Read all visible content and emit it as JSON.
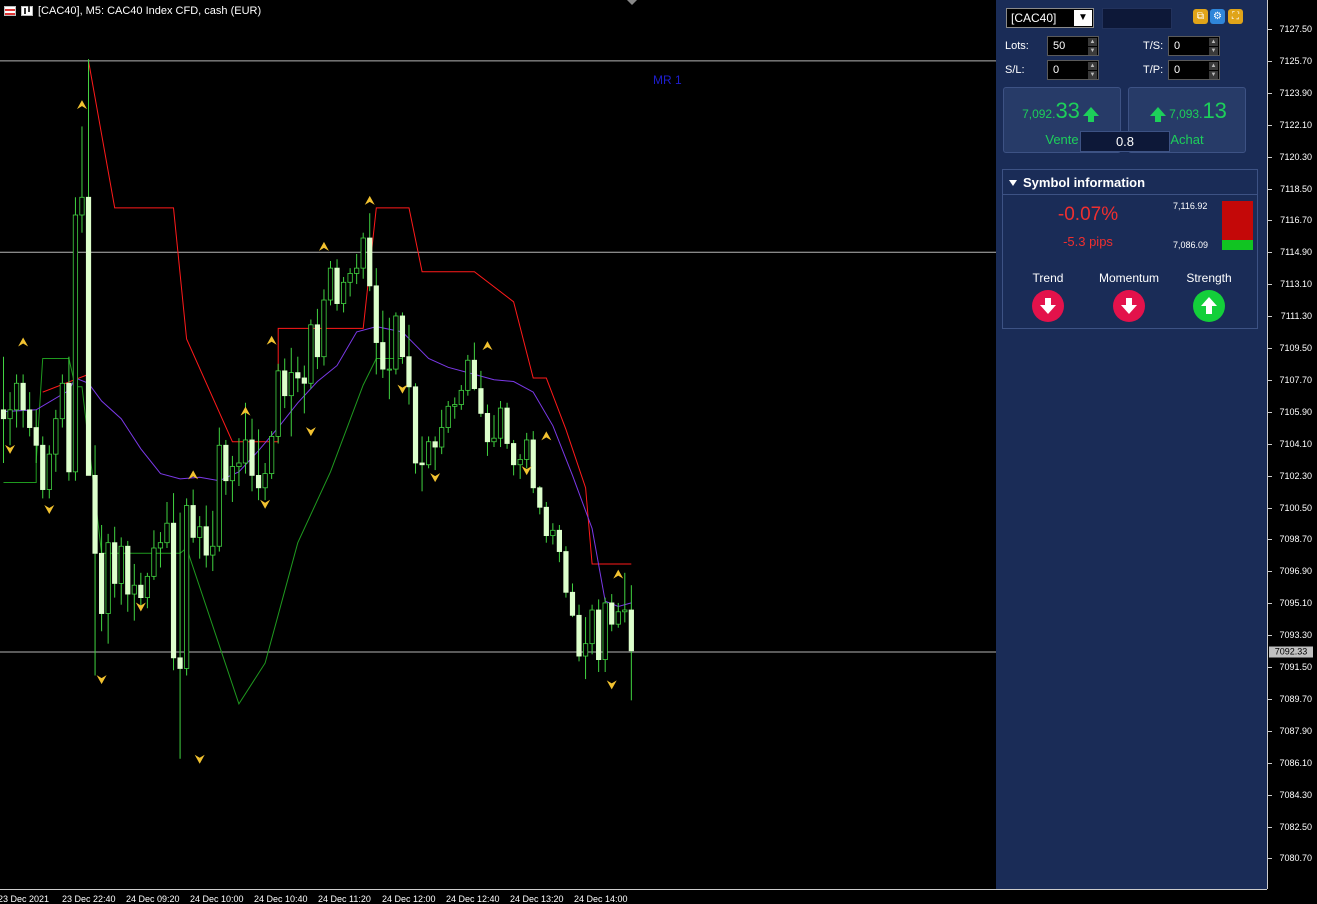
{
  "window": {
    "title": "[CAC40], M5:  CAC40 Index CFD, cash (EUR)",
    "chart_label": "MR 1"
  },
  "price_axis": {
    "ticks": [
      "7127.50",
      "7125.70",
      "7123.90",
      "7122.10",
      "7120.30",
      "7118.50",
      "7116.70",
      "7114.90",
      "7113.10",
      "7111.30",
      "7109.50",
      "7107.70",
      "7105.90",
      "7104.10",
      "7102.30",
      "7100.50",
      "7098.70",
      "7096.90",
      "7095.10",
      "7093.30",
      "7091.50",
      "7089.70",
      "7087.90",
      "7086.10",
      "7084.30",
      "7082.50",
      "7080.70"
    ],
    "current_price": "7092.33"
  },
  "time_axis": {
    "labels": [
      "23 Dec 2021",
      "23 Dec 22:40",
      "24 Dec 09:20",
      "24 Dec 10:00",
      "24 Dec 10:40",
      "24 Dec 11:20",
      "24 Dec 12:00",
      "24 Dec 12:40",
      "24 Dec 13:20",
      "24 Dec 14:00"
    ]
  },
  "panel": {
    "symbol": "[CAC40]",
    "lots_label": "Lots:",
    "lots_value": "50",
    "ts_label": "T/S:",
    "ts_value": "0",
    "sl_label": "S/L:",
    "sl_value": "0",
    "tp_label": "T/P:",
    "tp_value": "0",
    "sell": {
      "small": "7,092.",
      "big": "33",
      "label": "Vente"
    },
    "buy": {
      "small": "7,093.",
      "big": "13",
      "label": "Achat"
    },
    "spread": "0.8",
    "symbol_info": {
      "title": "Symbol information",
      "change_pct": "-0.07%",
      "change_pips": "-5.3 pips",
      "high": "7,116.92",
      "low": "7,086.09",
      "trend_label": "Trend",
      "trend": "down",
      "momentum_label": "Momentum",
      "momentum": "down",
      "strength_label": "Strength",
      "strength": "up"
    }
  },
  "colors": {
    "candle": "#ddffcc",
    "upper_band": "#ff1a1a",
    "lower_band": "#1f9a1f",
    "moving_average": "#7b39e8",
    "fractal": "#f2c230",
    "up_price": "#1dcf5a",
    "down_change": "#ef2f2f"
  },
  "chart_data": {
    "type": "candlestick",
    "symbol": "CAC40",
    "timeframe": "M5",
    "horizontal_levels": [
      7125.7,
      7114.9,
      7092.33
    ],
    "candles": [
      [
        7106.0,
        7109.0,
        7103.0,
        7105.5
      ],
      [
        7105.5,
        7107.0,
        7104.0,
        7106.0
      ],
      [
        7106.0,
        7108.0,
        7105.0,
        7107.5
      ],
      [
        7107.5,
        7108.0,
        7105.0,
        7106.0
      ],
      [
        7106.0,
        7107.0,
        7104.5,
        7105.0
      ],
      [
        7105.0,
        7106.0,
        7103.0,
        7104.0
      ],
      [
        7104.0,
        7104.5,
        7101.0,
        7101.5
      ],
      [
        7101.5,
        7104.0,
        7101.0,
        7103.5
      ],
      [
        7103.5,
        7106.0,
        7102.5,
        7105.5
      ],
      [
        7105.5,
        7108.0,
        7105.0,
        7107.5
      ],
      [
        7107.5,
        7109.0,
        7102.0,
        7102.5
      ],
      [
        7102.5,
        7118.0,
        7102.0,
        7117.0
      ],
      [
        7117.0,
        7122.0,
        7116.0,
        7118.0
      ],
      [
        7118.0,
        7125.8,
        7103.0,
        7102.3
      ],
      [
        7102.3,
        7104.0,
        7091.0,
        7097.9
      ],
      [
        7097.9,
        7099.5,
        7093.5,
        7094.5
      ],
      [
        7094.5,
        7099.0,
        7092.8,
        7098.5
      ],
      [
        7098.5,
        7099.4,
        7095.4,
        7096.2
      ],
      [
        7096.2,
        7098.8,
        7095.0,
        7098.3
      ],
      [
        7098.3,
        7098.6,
        7094.6,
        7095.6
      ],
      [
        7095.6,
        7097.3,
        7094.1,
        7096.1
      ],
      [
        7096.1,
        7096.8,
        7094.8,
        7095.4
      ],
      [
        7095.4,
        7096.8,
        7094.8,
        7096.6
      ],
      [
        7096.6,
        7099.2,
        7096.4,
        7098.2
      ],
      [
        7098.2,
        7099.1,
        7097.1,
        7098.5
      ],
      [
        7098.5,
        7100.8,
        7098.2,
        7099.6
      ],
      [
        7099.6,
        7101.3,
        7091.3,
        7092.0
      ],
      [
        7092.0,
        7100.2,
        7086.3,
        7091.4
      ],
      [
        7091.4,
        7101.0,
        7091.0,
        7100.6
      ],
      [
        7100.6,
        7101.5,
        7098.5,
        7098.8
      ],
      [
        7098.8,
        7100.0,
        7097.6,
        7099.4
      ],
      [
        7099.4,
        7100.6,
        7097.1,
        7097.8
      ],
      [
        7097.8,
        7100.3,
        7096.9,
        7098.3
      ],
      [
        7098.3,
        7105.0,
        7098.0,
        7104.0
      ],
      [
        7104.0,
        7104.3,
        7101.2,
        7102.0
      ],
      [
        7102.0,
        7103.4,
        7100.8,
        7102.8
      ],
      [
        7102.8,
        7104.4,
        7101.7,
        7103.0
      ],
      [
        7103.0,
        7106.4,
        7102.4,
        7104.3
      ],
      [
        7104.3,
        7105.5,
        7101.4,
        7102.3
      ],
      [
        7102.3,
        7104.9,
        7100.9,
        7101.6
      ],
      [
        7101.6,
        7103.0,
        7100.9,
        7102.4
      ],
      [
        7102.4,
        7104.8,
        7102.1,
        7104.5
      ],
      [
        7104.5,
        7108.6,
        7104.1,
        7108.2
      ],
      [
        7108.2,
        7108.9,
        7106.1,
        7106.8
      ],
      [
        7106.8,
        7109.5,
        7104.5,
        7108.1
      ],
      [
        7108.1,
        7109.0,
        7107.0,
        7107.8
      ],
      [
        7107.8,
        7108.5,
        7105.8,
        7107.5
      ],
      [
        7107.5,
        7111.1,
        7107.2,
        7110.8
      ],
      [
        7110.8,
        7111.7,
        7108.3,
        7109.0
      ],
      [
        7109.0,
        7112.8,
        7108.5,
        7112.2
      ],
      [
        7112.2,
        7114.4,
        7111.9,
        7114.0
      ],
      [
        7114.0,
        7114.5,
        7111.6,
        7112.0
      ],
      [
        7112.0,
        7113.5,
        7111.5,
        7113.2
      ],
      [
        7113.2,
        7114.0,
        7112.4,
        7113.7
      ],
      [
        7113.7,
        7114.8,
        7113.1,
        7114.0
      ],
      [
        7114.0,
        7116.0,
        7113.4,
        7115.7
      ],
      [
        7115.7,
        7117.1,
        7112.7,
        7113.0
      ],
      [
        7113.0,
        7114.0,
        7108.0,
        7109.8
      ],
      [
        7109.8,
        7111.6,
        7107.8,
        7108.3
      ],
      [
        7108.3,
        7111.2,
        7106.6,
        7108.3
      ],
      [
        7108.3,
        7111.5,
        7108.0,
        7111.3
      ],
      [
        7111.3,
        7111.5,
        7108.6,
        7109.0
      ],
      [
        7109.0,
        7110.8,
        7106.3,
        7107.3
      ],
      [
        7107.3,
        7107.5,
        7102.4,
        7103.0
      ],
      [
        7103.0,
        7104.5,
        7101.4,
        7102.9
      ],
      [
        7102.9,
        7104.5,
        7102.7,
        7104.2
      ],
      [
        7104.2,
        7104.5,
        7102.6,
        7103.9
      ],
      [
        7103.9,
        7106.0,
        7103.5,
        7105.0
      ],
      [
        7105.0,
        7106.5,
        7104.7,
        7106.2
      ],
      [
        7106.2,
        7106.7,
        7105.5,
        7106.3
      ],
      [
        7106.3,
        7107.4,
        7106.0,
        7107.1
      ],
      [
        7107.1,
        7109.1,
        7106.8,
        7108.8
      ],
      [
        7108.8,
        7109.8,
        7107.1,
        7107.2
      ],
      [
        7107.2,
        7108.2,
        7105.6,
        7105.8
      ],
      [
        7105.8,
        7106.3,
        7103.4,
        7104.2
      ],
      [
        7104.2,
        7105.7,
        7103.9,
        7104.4
      ],
      [
        7104.4,
        7106.5,
        7103.9,
        7106.1
      ],
      [
        7106.1,
        7106.4,
        7103.8,
        7104.1
      ],
      [
        7104.1,
        7104.3,
        7102.3,
        7102.9
      ],
      [
        7102.9,
        7103.5,
        7102.1,
        7103.2
      ],
      [
        7103.2,
        7104.7,
        7102.7,
        7104.3
      ],
      [
        7104.3,
        7104.8,
        7101.3,
        7101.6
      ],
      [
        7101.6,
        7101.7,
        7100.1,
        7100.5
      ],
      [
        7100.5,
        7100.8,
        7098.5,
        7098.9
      ],
      [
        7098.9,
        7099.6,
        7098.4,
        7099.2
      ],
      [
        7099.2,
        7099.5,
        7097.4,
        7098.0
      ],
      [
        7098.0,
        7098.3,
        7095.4,
        7095.7
      ],
      [
        7095.7,
        7096.2,
        7094.3,
        7094.4
      ],
      [
        7094.4,
        7095.0,
        7091.8,
        7092.1
      ],
      [
        7092.1,
        7094.3,
        7090.8,
        7092.8
      ],
      [
        7092.8,
        7095.0,
        7092.2,
        7094.7
      ],
      [
        7094.7,
        7095.3,
        7091.2,
        7091.9
      ],
      [
        7091.9,
        7095.4,
        7091.2,
        7095.1
      ],
      [
        7095.1,
        7095.6,
        7093.5,
        7093.9
      ],
      [
        7093.9,
        7095.1,
        7093.7,
        7094.6
      ],
      [
        7094.6,
        7096.8,
        7094.0,
        7094.7
      ],
      [
        7094.7,
        7096.1,
        7089.6,
        7092.4
      ]
    ],
    "upper_band": [
      [
        6,
        7107
      ],
      [
        13,
        7108
      ],
      [
        13,
        7125.7
      ],
      [
        17,
        7117.4
      ],
      [
        26,
        7117.4
      ],
      [
        28,
        7110
      ],
      [
        35,
        7104.2
      ],
      [
        42,
        7104.2
      ],
      [
        42,
        7110.6
      ],
      [
        52,
        7110.6
      ],
      [
        55,
        7110.6
      ],
      [
        57,
        7117.4
      ],
      [
        62,
        7117.4
      ],
      [
        64,
        7113.8
      ],
      [
        72,
        7113.8
      ],
      [
        78,
        7112.1
      ],
      [
        81,
        7107.8
      ],
      [
        83,
        7107.8
      ],
      [
        86,
        7104.9
      ],
      [
        89,
        7101.6
      ],
      [
        90,
        7097.3
      ],
      [
        96,
        7097.3
      ]
    ],
    "moving_average": [
      [
        0,
        7105.9
      ],
      [
        5,
        7106.0
      ],
      [
        10,
        7107.1
      ],
      [
        11,
        7107.8
      ],
      [
        13,
        7107.5
      ],
      [
        15,
        7106.5
      ],
      [
        18,
        7105.5
      ],
      [
        21,
        7103.8
      ],
      [
        24,
        7102.4
      ],
      [
        27,
        7102.1
      ],
      [
        30,
        7102.2
      ],
      [
        33,
        7102.0
      ],
      [
        36,
        7102.5
      ],
      [
        39,
        7103.7
      ],
      [
        42,
        7105.0
      ],
      [
        45,
        7106.4
      ],
      [
        48,
        7107.6
      ],
      [
        51,
        7108.5
      ],
      [
        54,
        7110.4
      ],
      [
        57,
        7110.7
      ],
      [
        61,
        7110.4
      ],
      [
        65,
        7108.9
      ],
      [
        68,
        7108.4
      ],
      [
        72,
        7108.0
      ],
      [
        75,
        7107.7
      ],
      [
        78,
        7107.6
      ],
      [
        81,
        7107.0
      ],
      [
        84,
        7105.1
      ],
      [
        87,
        7102.3
      ],
      [
        90,
        7099.3
      ],
      [
        92,
        7095.2
      ],
      [
        94,
        7094.9
      ],
      [
        96,
        7095.1
      ]
    ],
    "lower_band": [
      [
        0,
        7101.9
      ],
      [
        5,
        7101.9
      ],
      [
        5,
        7103.1
      ],
      [
        6,
        7108.9
      ],
      [
        10,
        7108.9
      ],
      [
        11,
        7107.3
      ],
      [
        12,
        7107.3
      ],
      [
        15,
        7097.9
      ],
      [
        27,
        7097.9
      ],
      [
        28,
        7098.2
      ],
      [
        36,
        7089.4
      ],
      [
        40,
        7091.7
      ],
      [
        45,
        7098.5
      ],
      [
        50,
        7102.5
      ],
      [
        55,
        7107.4
      ],
      [
        57,
        7108.9
      ],
      [
        61,
        7108.9
      ]
    ],
    "fractals_up": [
      [
        3,
        7109.8
      ],
      [
        12,
        7123.2
      ],
      [
        29,
        7102.3
      ],
      [
        37,
        7105.9
      ],
      [
        41,
        7109.9
      ],
      [
        49,
        7115.2
      ],
      [
        56,
        7117.8
      ],
      [
        74,
        7109.6
      ],
      [
        83,
        7104.5
      ],
      [
        94,
        7096.7
      ]
    ],
    "fractals_down": [
      [
        1,
        7103.8
      ],
      [
        7,
        7100.4
      ],
      [
        15,
        7090.8
      ],
      [
        21,
        7094.9
      ],
      [
        30,
        7086.3
      ],
      [
        40,
        7100.7
      ],
      [
        47,
        7104.8
      ],
      [
        61,
        7107.2
      ],
      [
        66,
        7102.2
      ],
      [
        80,
        7102.6
      ],
      [
        93,
        7090.5
      ]
    ]
  }
}
